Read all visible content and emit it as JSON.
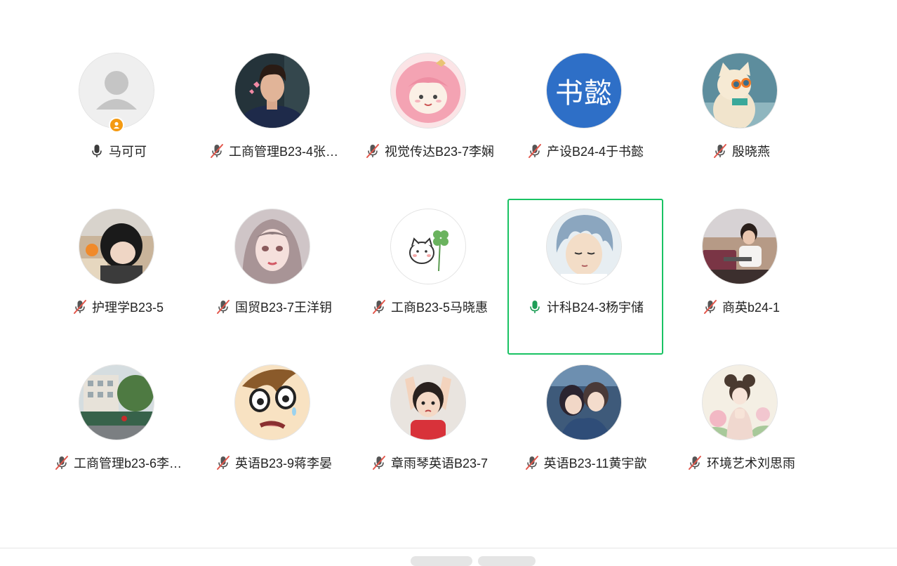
{
  "participants": [
    {
      "name": "马可可",
      "mic": "on",
      "avatar": "default-user-icon",
      "host_badge": true
    },
    {
      "name": "工商管理B23-4张…",
      "mic": "muted",
      "avatar": "photo-young-man"
    },
    {
      "name": "视觉传达B23-7李娴",
      "mic": "muted",
      "avatar": "anime-pink-hair-girl"
    },
    {
      "name": "产设B24-4于书懿",
      "mic": "muted",
      "avatar": "text-avatar",
      "avatar_text": "书懿",
      "avatar_color": "#2e6fc7"
    },
    {
      "name": "殷晓燕",
      "mic": "muted",
      "avatar": "cat-with-sunglasses"
    },
    {
      "name": "护理学B23-5",
      "mic": "muted",
      "avatar": "photo-girl-covering-face"
    },
    {
      "name": "国贸B23-7王洋钥",
      "mic": "muted",
      "avatar": "illustrated-girl"
    },
    {
      "name": "工商B23-5马晓惠",
      "mic": "muted",
      "avatar": "cat-with-clover"
    },
    {
      "name": "计科B24-3杨宇储",
      "mic": "on",
      "avatar": "anime-silver-hair-boy",
      "speaking": true
    },
    {
      "name": "商英b24-1",
      "mic": "muted",
      "avatar": "photo-girl-at-laptop"
    },
    {
      "name": "工商管理b23-6李…",
      "mic": "muted",
      "avatar": "photo-street-buildings"
    },
    {
      "name": "英语B23-9蒋李晏",
      "mic": "muted",
      "avatar": "cartoon-scared-face"
    },
    {
      "name": "章雨琴英语B23-7",
      "mic": "muted",
      "avatar": "photo-toddler-arms-up"
    },
    {
      "name": "英语B23-11黄宇歆",
      "mic": "muted",
      "avatar": "anime-couple"
    },
    {
      "name": "环境艺术刘思雨",
      "mic": "muted",
      "avatar": "illustrated-girl-with-buns"
    }
  ],
  "colors": {
    "speaking_border": "#19c363",
    "muted_slash": "#e2564b",
    "host_badge": "#f49a12",
    "mic_on": "#3c3c3c",
    "mic_speaking": "#1e9e57"
  }
}
